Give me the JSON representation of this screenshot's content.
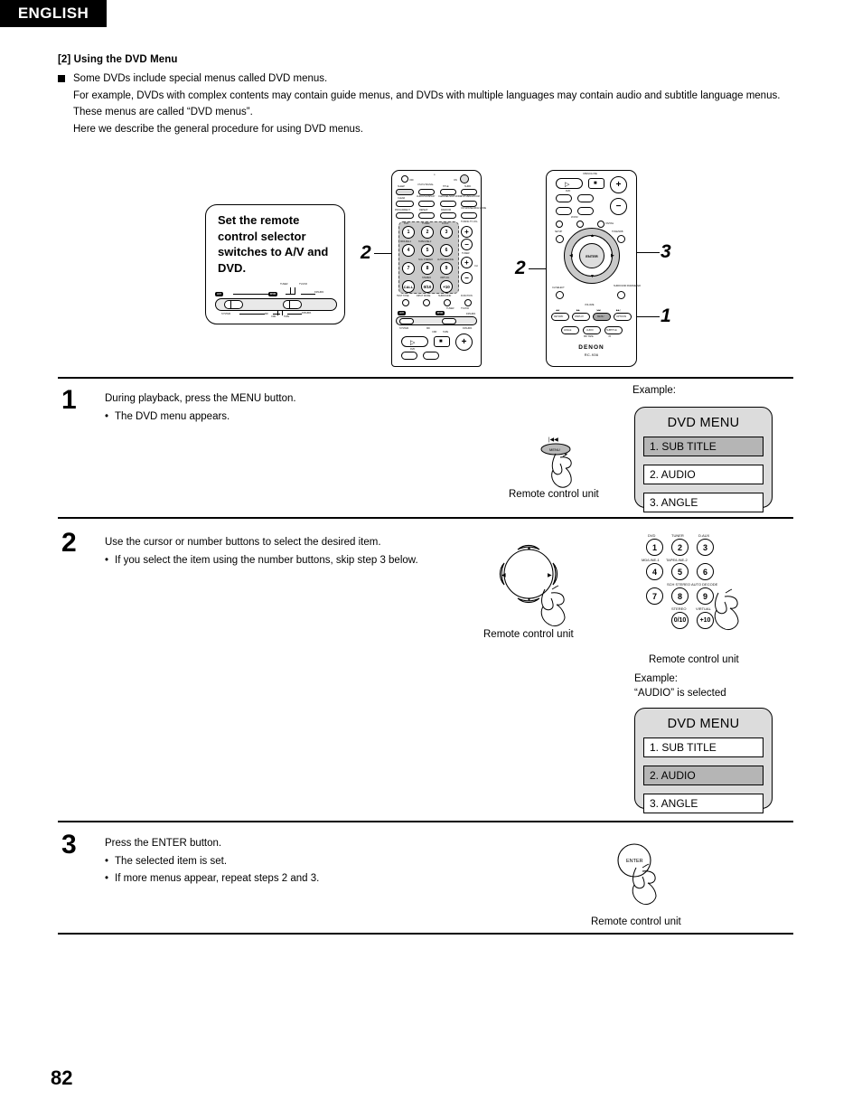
{
  "header": {
    "language_tab": "ENGLISH"
  },
  "intro": {
    "section_title": "[2] Using the DVD Menu",
    "bullet_line1": "Some DVDs include special menus called DVD menus.",
    "line2": "For example, DVDs with complex contents may contain guide menus, and DVDs with multiple languages may contain audio and subtitle language menus.",
    "line3": "These menus are called “DVD menus”.",
    "line4": "Here we describe the general procedure for using DVD menus."
  },
  "callout_balloon": {
    "text": "Set the remote control selector switches to A/V and DVD.",
    "switch_labels": {
      "left_tag": "A/V",
      "right_tag": "DVD",
      "top_right_1": "TUNER",
      "top_right_2": "TV/VCR",
      "top_right_3": "IN/SURR.",
      "bottom_left": "SYSTEM",
      "bottom_mid": "MD",
      "bottom_cdr": "CDR",
      "bottom_tape": "TAPE",
      "bottom_right": "IN/SURR."
    }
  },
  "diagram_callouts": [
    {
      "label": "2",
      "target": "number-buttons-left-remote"
    },
    {
      "label": "2",
      "target": "cursor-buttons-right-remote"
    },
    {
      "label": "3",
      "target": "enter-button-right-remote"
    },
    {
      "label": "1",
      "target": "menu-button-right-remote"
    }
  ],
  "remote_left": {
    "top_row_labels": [
      "OFF",
      "ON"
    ],
    "button_labels": [
      "SLEEP",
      "V.S.P./V.SIGNAL",
      "TITLE",
      "SURR.",
      "POWER",
      "TV/DVD",
      "TV/CH",
      "CLEAR",
      "AUDIO/V.DISPLAY",
      "CHANNEL/SKIP MODE",
      "TOP MENU/ZOOM",
      "T.V.SKIP",
      "SKIP+",
      "PROG/DIRECT",
      "REPEAT",
      "RANDOM",
      "CD SRS/SEARCH MODE",
      "MODE",
      "MEMO",
      "BAND",
      "TEST TONE",
      "INPUT MODE",
      "SURROUND",
      "FUNCTION",
      "TUNING TV VOL",
      "DVD",
      "TUNER",
      "D.AUX",
      "MD/LINE-1",
      "TAPE/LINE-2",
      "SCH STEREO",
      "AUTO DECODE",
      "STEREO",
      "VIRTUAL",
      "CALL",
      "CH",
      "DVD"
    ],
    "keypad": [
      "1",
      "2",
      "3",
      "4",
      "5",
      "6",
      "7",
      "8",
      "9",
      "0/10",
      "+10"
    ]
  },
  "remote_right": {
    "top_labels": [
      "OPEN/CLOSE"
    ],
    "button_labels": [
      "DVD",
      "SETUP",
      "TONE/SDB",
      "ON/TAG",
      "CH SELECT",
      "SURROUND PARAMETER",
      "RETURN",
      "DISPLAY",
      "MENU",
      "OPTIONS",
      "ANGLE",
      "AUDIO",
      "SUBTITLE",
      "MD TAPE",
      "/ B",
      "VOLUME",
      "ENTER"
    ],
    "brand": "DENON",
    "model": "RC-936"
  },
  "steps": [
    {
      "number": "1",
      "lead": "During playback, press the MENU button.",
      "bullets": [
        "The DVD menu appears."
      ],
      "device_caption": "Remote control unit",
      "example_label": "Example:",
      "dvd_menu": {
        "title": "DVD MENU",
        "items": [
          {
            "label": "1. SUB TITLE",
            "selected": true
          },
          {
            "label": "2. AUDIO",
            "selected": false
          },
          {
            "label": "3. ANGLE",
            "selected": false
          }
        ]
      }
    },
    {
      "number": "2",
      "lead": "Use the cursor or number buttons to select the desired item.",
      "bullets": [
        "If you select the item using the number buttons, skip step 3 below."
      ],
      "device_caption_left": "Remote control unit",
      "device_caption_right": "Remote control unit",
      "example_label": "Example:\n“AUDIO” is selected",
      "keypad_labels": {
        "r1": [
          "DVD",
          "TUNER",
          "D.AUX"
        ],
        "r2": [
          "MD/LINE-1",
          "TAPE/LINE-2",
          ""
        ],
        "r3": [
          "",
          "SCH STEREO",
          "AUTO DECODE"
        ],
        "r4": [
          "",
          "STEREO",
          "VIRTUAL"
        ]
      },
      "keypad_keys": [
        "1",
        "2",
        "3",
        "4",
        "5",
        "6",
        "7",
        "8",
        "9",
        "0/10",
        "+10"
      ],
      "dvd_menu": {
        "title": "DVD MENU",
        "items": [
          {
            "label": "1. SUB TITLE",
            "selected": false
          },
          {
            "label": "2. AUDIO",
            "selected": true
          },
          {
            "label": "3. ANGLE",
            "selected": false
          }
        ]
      }
    },
    {
      "number": "3",
      "lead": "Press the ENTER button.",
      "bullets": [
        "The selected item is set.",
        "If more menus appear, repeat steps 2 and 3."
      ],
      "device_caption": "Remote control unit",
      "enter_label": "ENTER"
    }
  ],
  "footer": {
    "page_number": "82"
  },
  "colors": {
    "ink": "#000000",
    "menu_box_bg": "#dcdcdc",
    "menu_row_selected": "#b5b5b5",
    "keypad_highlight": "#c9c9c9"
  }
}
